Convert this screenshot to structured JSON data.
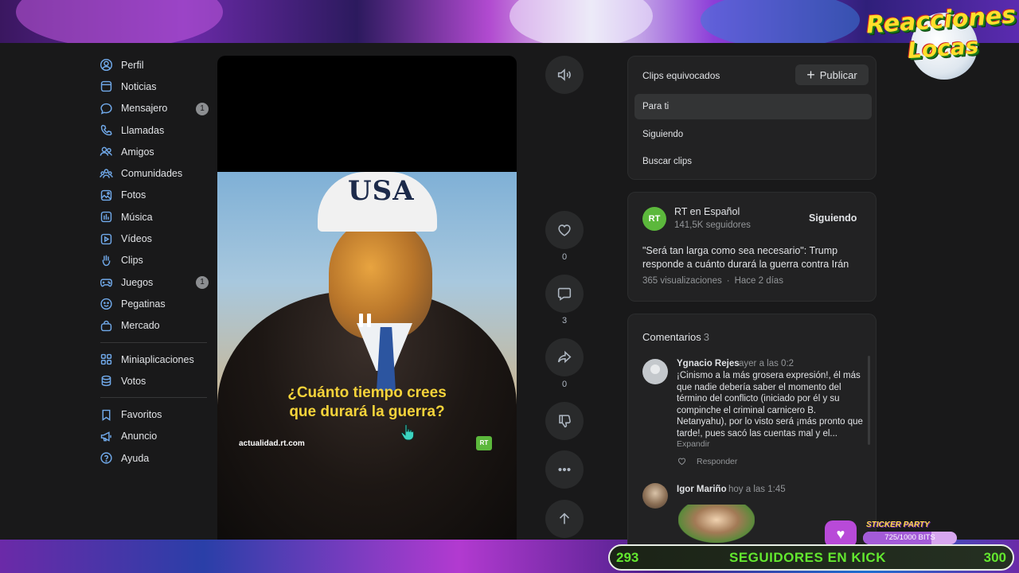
{
  "overlay": {
    "logo_line1": "Reacciones",
    "logo_line2": "Locas",
    "sticker_title": "STICKER PARTY",
    "sticker_progress": "725/1000 BITS",
    "sticker_fraction": 0.725,
    "goal_start": "293",
    "goal_label": "SEGUIDORES EN KICK",
    "goal_end": "300"
  },
  "sidebar": {
    "items": [
      {
        "label": "Perfil",
        "icon": "user-circle-icon"
      },
      {
        "label": "Noticias",
        "icon": "newspaper-icon"
      },
      {
        "label": "Mensajero",
        "icon": "chat-bubble-icon",
        "count": "1"
      },
      {
        "label": "Llamadas",
        "icon": "phone-icon"
      },
      {
        "label": "Amigos",
        "icon": "friends-icon"
      },
      {
        "label": "Comunidades",
        "icon": "communities-icon"
      },
      {
        "label": "Fotos",
        "icon": "photo-icon"
      },
      {
        "label": "Música",
        "icon": "music-icon"
      },
      {
        "label": "Vídeos",
        "icon": "video-icon"
      },
      {
        "label": "Clips",
        "icon": "clips-icon"
      },
      {
        "label": "Juegos",
        "icon": "gamepad-icon",
        "count": "1"
      },
      {
        "label": "Pegatinas",
        "icon": "sticker-smile-icon"
      },
      {
        "label": "Mercado",
        "icon": "shopping-bag-icon"
      }
    ],
    "items2": [
      {
        "label": "Miniaplicaciones",
        "icon": "apps-grid-icon"
      },
      {
        "label": "Votos",
        "icon": "coins-icon"
      }
    ],
    "items3": [
      {
        "label": "Favoritos",
        "icon": "bookmark-icon"
      },
      {
        "label": "Anuncio",
        "icon": "megaphone-icon"
      },
      {
        "label": "Ayuda",
        "icon": "help-circle-icon"
      }
    ]
  },
  "player": {
    "hat_text": "USA",
    "caption_line1": "¿Cuánto tiempo crees",
    "caption_line2": "que durará la guerra?",
    "source": "actualidad.rt.com",
    "badge": "RT"
  },
  "actions": {
    "likes": "0",
    "comments": "3",
    "shares": "0"
  },
  "clips": {
    "title": "Clips equivocados",
    "publish_label": "Publicar",
    "menu": [
      "Para ti",
      "Siguiendo",
      "Buscar clips"
    ]
  },
  "channel": {
    "avatar": "RT",
    "name": "RT en Español",
    "followers": "141,5K seguidores",
    "follow_state": "Siguiendo",
    "description": "\"Será tan larga como sea necesario\": Trump responde a cuánto durará la guerra contra Irán",
    "views": "365 visualizaciones",
    "dot": "·",
    "age": "Hace 2 días"
  },
  "comments": {
    "title": "Comentarios",
    "count": "3",
    "list": [
      {
        "author": "Ygnacio Rejes",
        "time": "ayer a las 0:2",
        "text": "¡Cinismo a la más grosera expresión!, él más que nadie debería saber el momento del término del conflicto (iniciado por él y su compinche el criminal carnicero B. Netanyahu), por lo visto será ¡más pronto que tarde!, pues sacó las cuentas mal y el...",
        "expand": "Expandir",
        "reply": "Responder"
      },
      {
        "author": "Igor Mariño",
        "time": "hoy a las 1:45"
      }
    ]
  }
}
